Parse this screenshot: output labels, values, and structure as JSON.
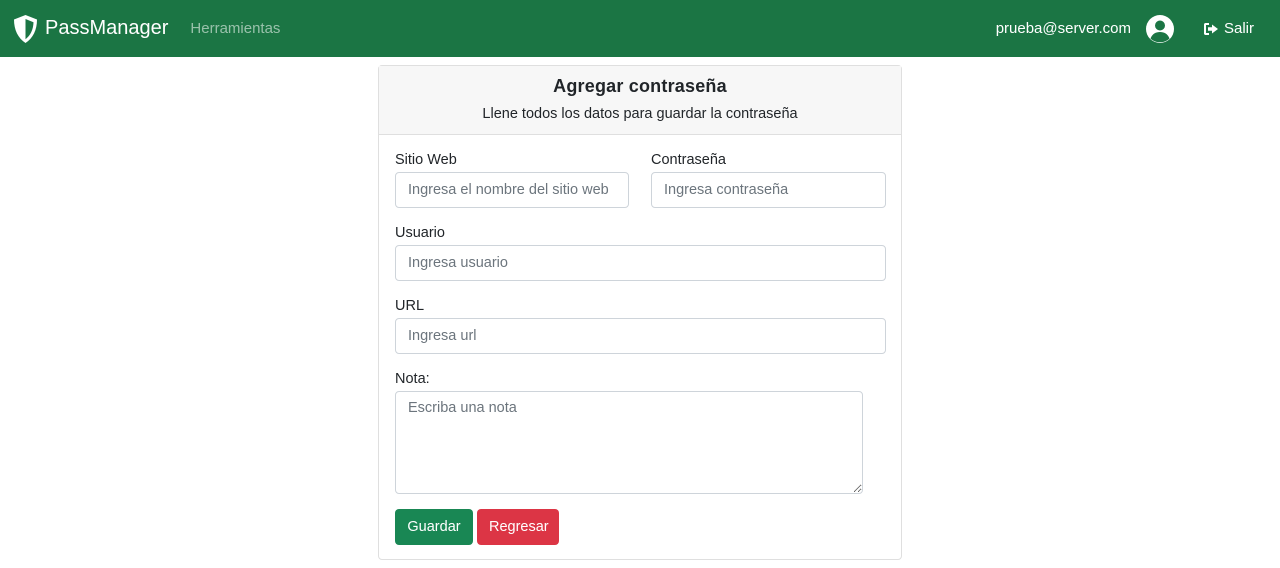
{
  "navbar": {
    "brand": "PassManager",
    "tools_link": "Herramientas",
    "user_email": "prueba@server.com",
    "logout_label": "Salir"
  },
  "form": {
    "title": "Agregar contraseña",
    "subtitle": "Llene todos los datos para guardar la contraseña",
    "website_label": "Sitio Web",
    "website_placeholder": "Ingresa el nombre del sitio web",
    "password_label": "Contraseña",
    "password_placeholder": "Ingresa contraseña",
    "user_label": "Usuario",
    "user_placeholder": "Ingresa usuario",
    "url_label": "URL",
    "url_placeholder": "Ingresa url",
    "note_label": "Nota:",
    "note_placeholder": "Escriba una nota",
    "save_label": "Guardar",
    "back_label": "Regresar"
  },
  "colors": {
    "navbar_bg": "#1b7544",
    "save_button": "#198754",
    "back_button": "#dc3545"
  },
  "icons": {
    "brand": "shield-icon",
    "user": "user-circle-icon",
    "logout": "sign-out-icon"
  }
}
